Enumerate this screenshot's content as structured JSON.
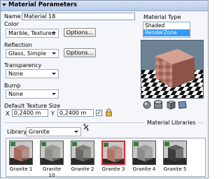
{
  "panel": {
    "title": "Material Parameters"
  },
  "name": {
    "label": "Name",
    "value": "Material 18"
  },
  "color": {
    "label": "Color",
    "value": "Marble, Textured",
    "options_label": "Options..."
  },
  "reflection": {
    "label": "Reflection",
    "value": "Glass, Simple",
    "options_label": "Options..."
  },
  "transparency": {
    "label": "Transparency",
    "value": "None"
  },
  "bump": {
    "label": "Bump",
    "value": "None"
  },
  "texture_size": {
    "label": "Default Texture Size",
    "x_label": "X",
    "x_value": "0,2400 m",
    "y_label": "Y",
    "y_value": "0,2400 m",
    "checkbox_mark": "✓"
  },
  "material_type": {
    "label": "Material Type",
    "options": [
      "Shaded",
      "RenderZone"
    ],
    "selected": "RenderZone"
  },
  "libraries": {
    "section_title": "Material Libraries",
    "library_label": "Library:",
    "library_value": "Granite",
    "items": [
      {
        "label": "Granite 1",
        "color": "#a86a5c"
      },
      {
        "label": "Granite 10",
        "color": "#8f8c86"
      },
      {
        "label": "Granite 2",
        "color": "#6c6a66"
      },
      {
        "label": "Granite 3",
        "color": "#b07466",
        "selected": true
      },
      {
        "label": "Granite 4",
        "color": "#8d8d8d"
      },
      {
        "label": "Granite 5",
        "color": "#3e3e3e"
      }
    ]
  },
  "icons": [
    "collapse-arrow-icon",
    "sphere-icon",
    "cylinder-icon",
    "cube-icon",
    "plane-icon",
    "lock-icon",
    "pin-icon",
    "small-material-icon"
  ],
  "colors": {
    "selection": "#3399ff",
    "selected_thumb_border": "#e0282d",
    "header": "#c9d7ee"
  }
}
